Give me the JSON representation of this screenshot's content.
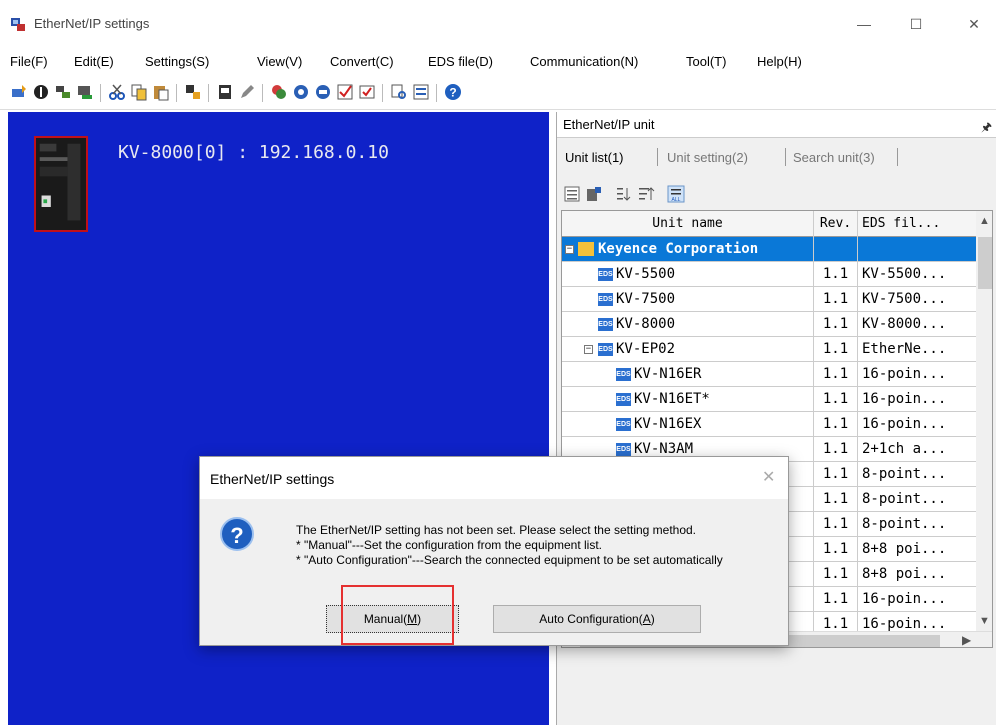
{
  "window": {
    "title": "EtherNet/IP settings",
    "controls": {
      "minimize": "—",
      "maximize": "☐",
      "close": "✕"
    }
  },
  "menubar": {
    "items": [
      "File(F)",
      "Edit(E)",
      "Settings(S)",
      "View(V)",
      "Convert(C)",
      "EDS file(D)",
      "Communication(N)",
      "Tool(T)",
      "Help(H)"
    ]
  },
  "canvas": {
    "device_label": "KV-8000[0]  : 192.168.0.10"
  },
  "panel": {
    "title": "EtherNet/IP unit",
    "pin": "🖈",
    "tabs": [
      "Unit list(1)",
      "Unit setting(2)",
      "Search unit(3)"
    ],
    "columns": [
      "Unit name",
      "Rev.",
      "EDS fil..."
    ],
    "rows": [
      {
        "name": "Keyence Corporation",
        "rev": "",
        "eds": ""
      },
      {
        "name": "KV-5500",
        "rev": "1.1",
        "eds": "KV-5500..."
      },
      {
        "name": "KV-7500",
        "rev": "1.1",
        "eds": "KV-7500..."
      },
      {
        "name": "KV-8000",
        "rev": "1.1",
        "eds": "KV-8000..."
      },
      {
        "name": "KV-EP02",
        "rev": "1.1",
        "eds": "EtherNe..."
      },
      {
        "name": "KV-N16ER",
        "rev": "1.1",
        "eds": "16-poin..."
      },
      {
        "name": "KV-N16ET*",
        "rev": "1.1",
        "eds": "16-poin..."
      },
      {
        "name": "KV-N16EX",
        "rev": "1.1",
        "eds": "16-poin..."
      },
      {
        "name": "KV-N3AM",
        "rev": "1.1",
        "eds": "2+1ch a..."
      },
      {
        "name": "",
        "rev": "1.1",
        "eds": "8-point..."
      },
      {
        "name": "",
        "rev": "1.1",
        "eds": "8-point..."
      },
      {
        "name": "",
        "rev": "1.1",
        "eds": "8-point..."
      },
      {
        "name": "",
        "rev": "1.1",
        "eds": "8+8 poi..."
      },
      {
        "name": "",
        "rev": "1.1",
        "eds": "8+8 poi..."
      },
      {
        "name": "",
        "rev": "1.1",
        "eds": "16-poin..."
      },
      {
        "name": "",
        "rev": "1.1",
        "eds": "16-poin..."
      }
    ],
    "eds_icon": "EDS"
  },
  "dialog": {
    "title": "EtherNet/IP settings",
    "close": "✕",
    "icon": "?",
    "lines": [
      "The EtherNet/IP setting has not been set. Please select the setting method.",
      "* \"Manual\"---Set the configuration from the equipment list.",
      "* \"Auto Configuration\"---Search the connected equipment to be set automatically"
    ],
    "manual_prefix": "Manual(",
    "manual_key": "M",
    "auto_prefix": "Auto Configuration(",
    "auto_key": "A",
    "suffix": ")"
  },
  "colors": {
    "canvas_bg": "#0f22c8",
    "selected_row": "#0a78d7",
    "highlight": "#e53030"
  }
}
